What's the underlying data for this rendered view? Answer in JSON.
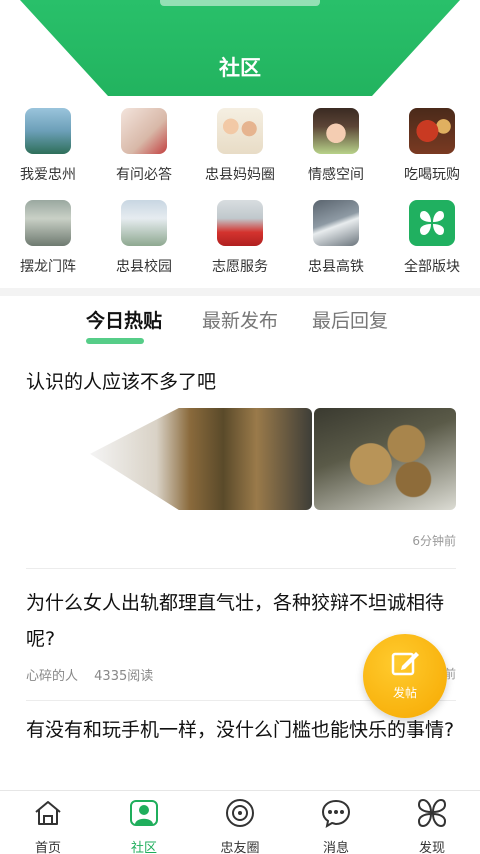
{
  "header": {
    "title": "社区"
  },
  "categories": [
    {
      "label": "我爱忠州",
      "icon": "city-photo-icon"
    },
    {
      "label": "有问必答",
      "icon": "qa-photo-icon"
    },
    {
      "label": "忠县妈妈圈",
      "icon": "family-photo-icon"
    },
    {
      "label": "情感空间",
      "icon": "girl-photo-icon"
    },
    {
      "label": "吃喝玩购",
      "icon": "food-photo-icon"
    },
    {
      "label": "摆龙门阵",
      "icon": "people-photo-icon"
    },
    {
      "label": "忠县校园",
      "icon": "campus-photo-icon"
    },
    {
      "label": "志愿服务",
      "icon": "volunteer-photo-icon"
    },
    {
      "label": "忠县高铁",
      "icon": "train-photo-icon"
    },
    {
      "label": "全部版块",
      "icon": "all-sections-icon"
    }
  ],
  "tabs": [
    {
      "label": "今日热贴",
      "active": true
    },
    {
      "label": "最新发布",
      "active": false
    },
    {
      "label": "最后回复",
      "active": false
    }
  ],
  "posts": [
    {
      "title": "认识的人应该不多了吧",
      "time": "6分钟前"
    },
    {
      "title": "为什么女人出轨都理直气壮，各种狡辩不坦诚相待呢?",
      "author": "心碎的人",
      "reads": "4335阅读",
      "time": "前"
    },
    {
      "title": "有没有和玩手机一样，没什么门槛也能快乐的事情?"
    }
  ],
  "fab": {
    "label": "发帖"
  },
  "bottom_nav": [
    {
      "label": "首页",
      "icon": "home-icon"
    },
    {
      "label": "社区",
      "icon": "community-icon",
      "active": true
    },
    {
      "label": "忠友圈",
      "icon": "moments-icon"
    },
    {
      "label": "消息",
      "icon": "message-icon"
    },
    {
      "label": "发现",
      "icon": "discover-icon"
    }
  ],
  "colors": {
    "accent": "#22b35f",
    "fab": "#f6a800"
  }
}
